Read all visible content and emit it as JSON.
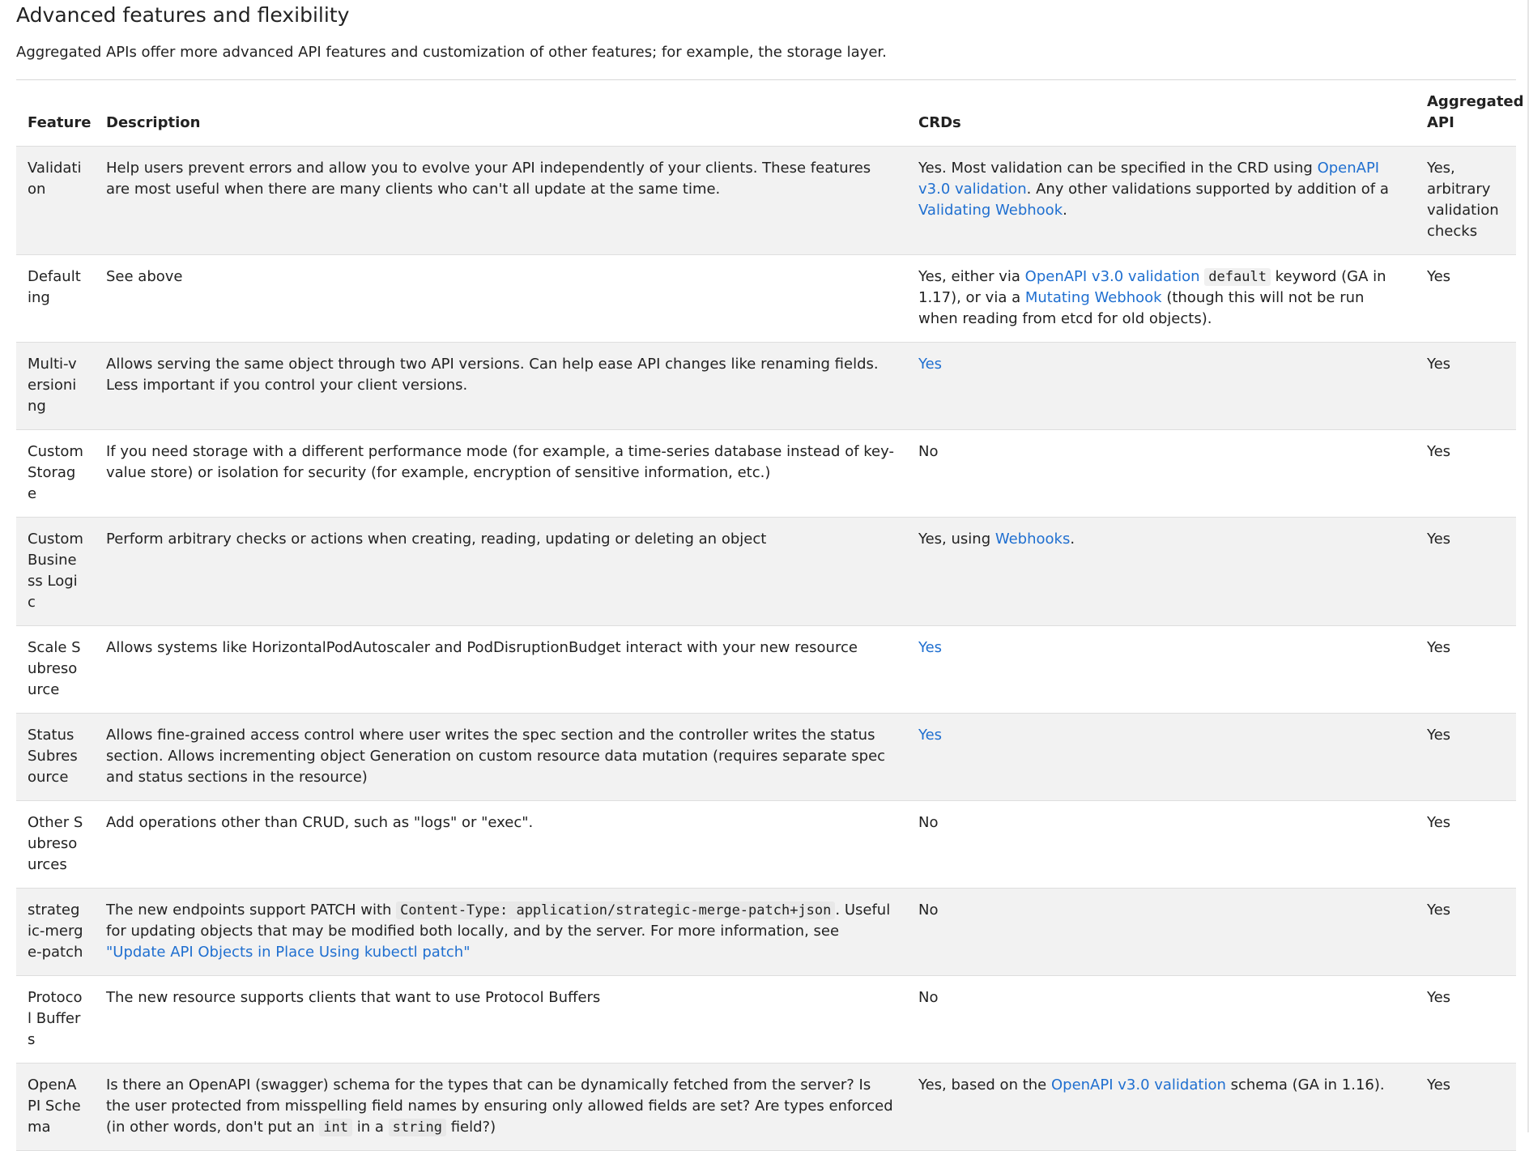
{
  "heading": "Advanced features and flexibility",
  "intro": "Aggregated APIs offer more advanced API features and customization of other features; for example, the storage layer.",
  "table": {
    "headers": {
      "feature": "Feature",
      "description": "Description",
      "crds": "CRDs",
      "aggregated": "Aggregated API"
    },
    "rows": [
      {
        "feature": "Validation",
        "description": [
          {
            "t": "Help users prevent errors and allow you to evolve your API independently of your clients. These features are most useful when there are many clients who can't all update at the same time."
          }
        ],
        "crds": [
          {
            "t": "Yes. Most validation can be specified in the CRD using "
          },
          {
            "t": "OpenAPI v3.0 validation",
            "link": true
          },
          {
            "t": ". Any other validations supported by addition of a "
          },
          {
            "t": "Validating Webhook",
            "link": true
          },
          {
            "t": "."
          }
        ],
        "aggregated": "Yes, arbitrary validation checks"
      },
      {
        "feature": "Defaulting",
        "description": [
          {
            "t": "See above"
          }
        ],
        "crds": [
          {
            "t": "Yes, either via "
          },
          {
            "t": "OpenAPI v3.0 validation",
            "link": true
          },
          {
            "t": " "
          },
          {
            "t": "default",
            "code": true
          },
          {
            "t": " keyword (GA in 1.17), or via a "
          },
          {
            "t": "Mutating Webhook",
            "link": true
          },
          {
            "t": " (though this will not be run when reading from etcd for old objects)."
          }
        ],
        "aggregated": "Yes"
      },
      {
        "feature": "Multi-versioning",
        "description": [
          {
            "t": "Allows serving the same object through two API versions. Can help ease API changes like renaming fields. Less important if you control your client versions."
          }
        ],
        "crds": [
          {
            "t": "Yes",
            "link": true
          }
        ],
        "aggregated": "Yes"
      },
      {
        "feature": "Custom Storage",
        "description": [
          {
            "t": "If you need storage with a different performance mode (for example, a time-series database instead of key-value store) or isolation for security (for example, encryption of sensitive information, etc.)"
          }
        ],
        "crds": [
          {
            "t": "No"
          }
        ],
        "aggregated": "Yes"
      },
      {
        "feature": "Custom Business Logic",
        "description": [
          {
            "t": "Perform arbitrary checks or actions when creating, reading, updating or deleting an object"
          }
        ],
        "crds": [
          {
            "t": "Yes, using "
          },
          {
            "t": "Webhooks",
            "link": true
          },
          {
            "t": "."
          }
        ],
        "aggregated": "Yes"
      },
      {
        "feature": "Scale Subresource",
        "description": [
          {
            "t": "Allows systems like HorizontalPodAutoscaler and PodDisruptionBudget interact with your new resource"
          }
        ],
        "crds": [
          {
            "t": "Yes",
            "link": true
          }
        ],
        "aggregated": "Yes"
      },
      {
        "feature": "Status Subresource",
        "description": [
          {
            "t": "Allows fine-grained access control where user writes the spec section and the controller writes the status section. Allows incrementing object Generation on custom resource data mutation (requires separate spec and status sections in the resource)"
          }
        ],
        "crds": [
          {
            "t": "Yes",
            "link": true
          }
        ],
        "aggregated": "Yes"
      },
      {
        "feature": "Other Subresources",
        "description": [
          {
            "t": "Add operations other than CRUD, such as \"logs\" or \"exec\"."
          }
        ],
        "crds": [
          {
            "t": "No"
          }
        ],
        "aggregated": "Yes"
      },
      {
        "feature": "strategic-merge-patch",
        "description": [
          {
            "t": "The new endpoints support PATCH with "
          },
          {
            "t": "Content-Type: application/strategic-merge-patch+json",
            "code": true
          },
          {
            "t": ". Useful for updating objects that may be modified both locally, and by the server. For more information, see "
          },
          {
            "t": "\"Update API Objects in Place Using kubectl patch\"",
            "link": true
          }
        ],
        "crds": [
          {
            "t": "No"
          }
        ],
        "aggregated": "Yes"
      },
      {
        "feature": "Protocol Buffers",
        "description": [
          {
            "t": "The new resource supports clients that want to use Protocol Buffers"
          }
        ],
        "crds": [
          {
            "t": "No"
          }
        ],
        "aggregated": "Yes"
      },
      {
        "feature": "OpenAPI Schema",
        "description": [
          {
            "t": "Is there an OpenAPI (swagger) schema for the types that can be dynamically fetched from the server? Is the user protected from misspelling field names by ensuring only allowed fields are set? Are types enforced (in other words, don't put an "
          },
          {
            "t": "int",
            "code": true
          },
          {
            "t": " in a "
          },
          {
            "t": "string",
            "code": true
          },
          {
            "t": " field?)"
          }
        ],
        "crds": [
          {
            "t": "Yes, based on the "
          },
          {
            "t": "OpenAPI v3.0 validation",
            "link": true
          },
          {
            "t": " schema (GA in 1.16)."
          }
        ],
        "aggregated": "Yes"
      }
    ]
  }
}
